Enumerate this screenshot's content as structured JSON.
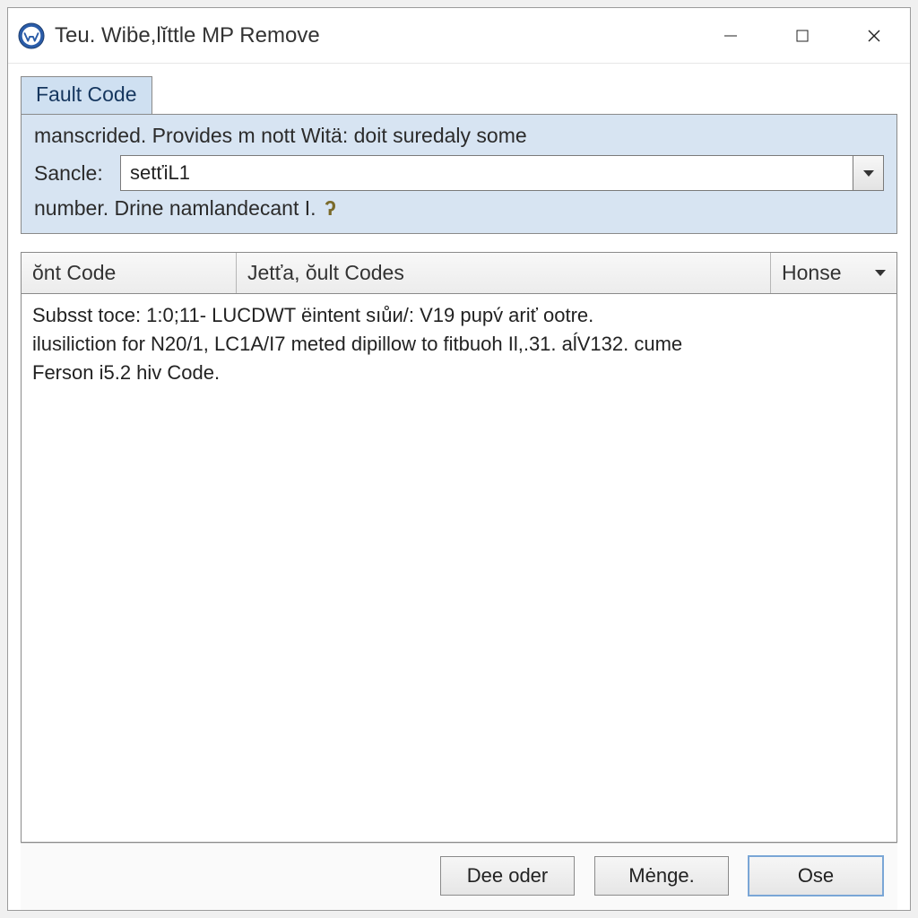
{
  "window": {
    "title": "Teu. Wiḃe,lĭttle MP Remove"
  },
  "tab": {
    "label": "Fault Code"
  },
  "header": {
    "description": "manscrided. Provides m nott Witä: doit suredaly some",
    "sancle_label": "Sancle:",
    "sancle_value": "setťiL1",
    "subline": "number. Drine namlandecant I."
  },
  "table": {
    "columns": {
      "col1": "ŏnt Code",
      "col2": "Jetťa, ŏult Codes",
      "col3": "Honse"
    },
    "body": "Subsst toce: 1:0;11- LUCDWT ëintent sıůи/: V19 pupv́ ariť ootre.\nilusiliction for N20/1, LC1A/I7 meted dipillow to fitbuoh Il,.31. aĺV132. cume\nFerson i5.2 hiv Code."
  },
  "footer": {
    "buttons": [
      "Dee oder",
      "Mėnge.",
      "Ose"
    ]
  }
}
